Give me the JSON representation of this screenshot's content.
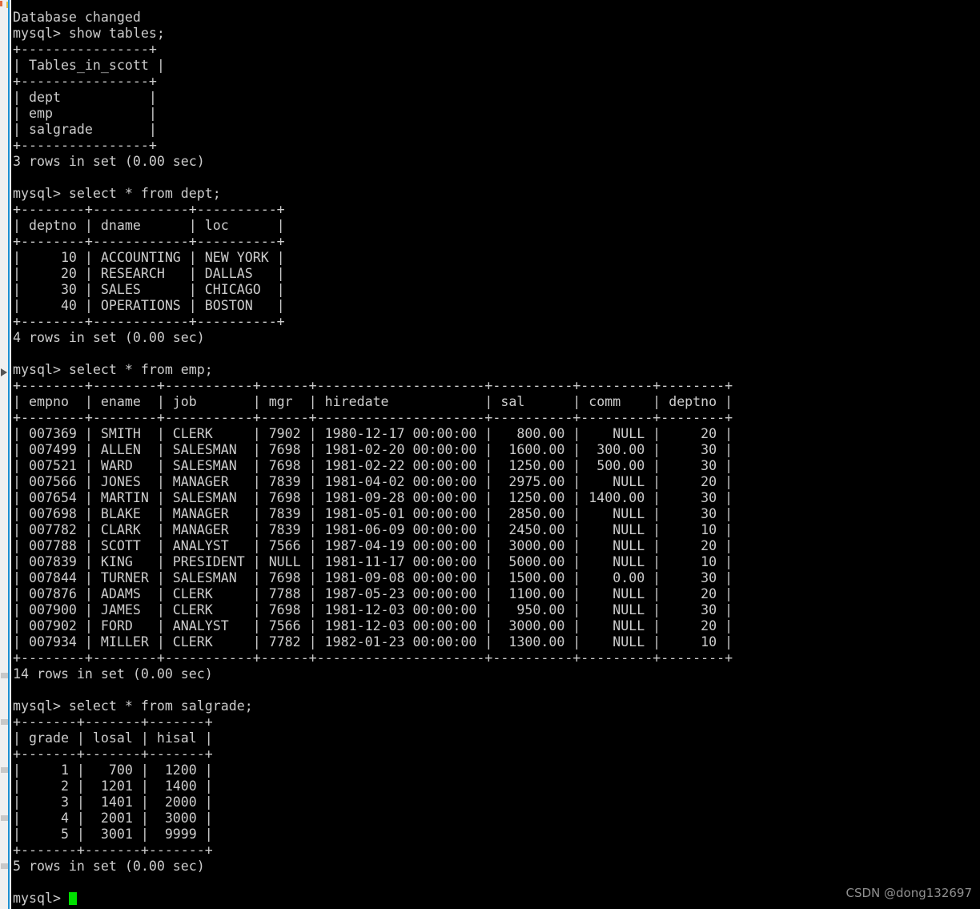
{
  "app": {
    "type": "mysql-cli-terminal",
    "background_color": "#000000",
    "text_color": "#cccccc",
    "cursor_color": "#00e000",
    "gutter_color": "#f0f0f0",
    "gutter_border_color": "#1e90d2"
  },
  "prompt": {
    "label": "mysql>",
    "current_line": "mysql> ",
    "cursor": "block"
  },
  "watermark": {
    "text": "CSDN @dong132697"
  },
  "session": {
    "status_message": "Database changed",
    "blocks": [
      {
        "command": "mysql> show tables;",
        "result_footer": "3 rows in set (0.00 sec)",
        "table": {
          "columns": [
            "Tables_in_scott"
          ],
          "widths": [
            16
          ],
          "aligns": [
            "left"
          ],
          "rows": [
            [
              "dept"
            ],
            [
              "emp"
            ],
            [
              "salgrade"
            ]
          ]
        }
      },
      {
        "command": "mysql> select * from dept;",
        "result_footer": "4 rows in set (0.00 sec)",
        "table": {
          "columns": [
            "deptno",
            "dname",
            "loc"
          ],
          "widths": [
            8,
            12,
            10
          ],
          "aligns": [
            "right",
            "left",
            "left"
          ],
          "rows": [
            [
              "10",
              "ACCOUNTING",
              "NEW YORK"
            ],
            [
              "20",
              "RESEARCH",
              "DALLAS"
            ],
            [
              "30",
              "SALES",
              "CHICAGO"
            ],
            [
              "40",
              "OPERATIONS",
              "BOSTON"
            ]
          ]
        }
      },
      {
        "command": "mysql> select * from emp;",
        "result_footer": "14 rows in set (0.00 sec)",
        "table": {
          "columns": [
            "empno",
            "ename",
            "job",
            "mgr",
            "hiredate",
            "sal",
            "comm",
            "deptno"
          ],
          "widths": [
            8,
            8,
            11,
            6,
            21,
            10,
            9,
            8
          ],
          "aligns": [
            "right",
            "left",
            "left",
            "right",
            "left",
            "right",
            "right",
            "right"
          ],
          "rows": [
            [
              "007369",
              "SMITH",
              "CLERK",
              "7902",
              "1980-12-17 00:00:00",
              "800.00",
              "NULL",
              "20"
            ],
            [
              "007499",
              "ALLEN",
              "SALESMAN",
              "7698",
              "1981-02-20 00:00:00",
              "1600.00",
              "300.00",
              "30"
            ],
            [
              "007521",
              "WARD",
              "SALESMAN",
              "7698",
              "1981-02-22 00:00:00",
              "1250.00",
              "500.00",
              "30"
            ],
            [
              "007566",
              "JONES",
              "MANAGER",
              "7839",
              "1981-04-02 00:00:00",
              "2975.00",
              "NULL",
              "20"
            ],
            [
              "007654",
              "MARTIN",
              "SALESMAN",
              "7698",
              "1981-09-28 00:00:00",
              "1250.00",
              "1400.00",
              "30"
            ],
            [
              "007698",
              "BLAKE",
              "MANAGER",
              "7839",
              "1981-05-01 00:00:00",
              "2850.00",
              "NULL",
              "30"
            ],
            [
              "007782",
              "CLARK",
              "MANAGER",
              "7839",
              "1981-06-09 00:00:00",
              "2450.00",
              "NULL",
              "10"
            ],
            [
              "007788",
              "SCOTT",
              "ANALYST",
              "7566",
              "1987-04-19 00:00:00",
              "3000.00",
              "NULL",
              "20"
            ],
            [
              "007839",
              "KING",
              "PRESIDENT",
              "NULL",
              "1981-11-17 00:00:00",
              "5000.00",
              "NULL",
              "10"
            ],
            [
              "007844",
              "TURNER",
              "SALESMAN",
              "7698",
              "1981-09-08 00:00:00",
              "1500.00",
              "0.00",
              "30"
            ],
            [
              "007876",
              "ADAMS",
              "CLERK",
              "7788",
              "1987-05-23 00:00:00",
              "1100.00",
              "NULL",
              "20"
            ],
            [
              "007900",
              "JAMES",
              "CLERK",
              "7698",
              "1981-12-03 00:00:00",
              "950.00",
              "NULL",
              "30"
            ],
            [
              "007902",
              "FORD",
              "ANALYST",
              "7566",
              "1981-12-03 00:00:00",
              "3000.00",
              "NULL",
              "20"
            ],
            [
              "007934",
              "MILLER",
              "CLERK",
              "7782",
              "1982-01-23 00:00:00",
              "1300.00",
              "NULL",
              "10"
            ]
          ]
        }
      },
      {
        "command": "mysql> select * from salgrade;",
        "result_footer": "5 rows in set (0.00 sec)",
        "table": {
          "columns": [
            "grade",
            "losal",
            "hisal"
          ],
          "widths": [
            7,
            7,
            7
          ],
          "aligns": [
            "right",
            "right",
            "right"
          ],
          "rows": [
            [
              "1",
              "700",
              "1200"
            ],
            [
              "2",
              "1201",
              "1400"
            ],
            [
              "3",
              "1401",
              "2000"
            ],
            [
              "4",
              "2001",
              "3000"
            ],
            [
              "5",
              "3001",
              "9999"
            ]
          ]
        }
      }
    ]
  }
}
